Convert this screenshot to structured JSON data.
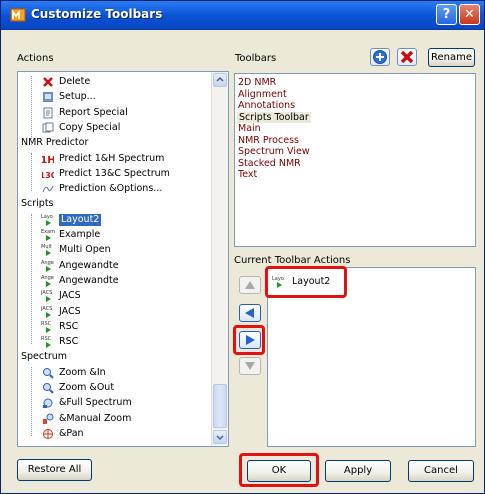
{
  "window": {
    "title": "Customize Toolbars"
  },
  "actions": {
    "label": "Actions",
    "items": [
      {
        "text": "Delete",
        "icon": "red-x-icon",
        "indent": 2
      },
      {
        "text": "Setup...",
        "icon": "setup-icon",
        "indent": 2
      },
      {
        "text": "Report Special",
        "icon": "report-icon",
        "indent": 2
      },
      {
        "text": "Copy Special",
        "icon": "copy-icon",
        "indent": 2
      },
      {
        "text": "NMR Predictor",
        "icon": "",
        "indent": 0
      },
      {
        "text": "Predict 1&H Spectrum",
        "icon": "1h-icon",
        "indent": 2
      },
      {
        "text": "Predict 13&C Spectrum",
        "icon": "13c-icon",
        "indent": 2
      },
      {
        "text": "Prediction &Options...",
        "icon": "prediction-icon",
        "indent": 2
      },
      {
        "text": "Scripts",
        "icon": "",
        "indent": 0
      },
      {
        "text": "Layout2",
        "icon": "script-icon",
        "indent": 2,
        "selected": true
      },
      {
        "text": "Example",
        "icon": "script-icon",
        "indent": 2
      },
      {
        "text": "Multi Open",
        "icon": "script-icon",
        "indent": 2
      },
      {
        "text": "Angewandte",
        "icon": "script-icon",
        "indent": 2
      },
      {
        "text": "Angewandte",
        "icon": "script-icon",
        "indent": 2
      },
      {
        "text": "JACS",
        "icon": "script-icon",
        "indent": 2
      },
      {
        "text": "JACS",
        "icon": "script-icon",
        "indent": 2
      },
      {
        "text": "RSC",
        "icon": "script-icon",
        "indent": 2
      },
      {
        "text": "RSC",
        "icon": "script-icon",
        "indent": 2
      },
      {
        "text": "Spectrum",
        "icon": "",
        "indent": 0
      },
      {
        "text": "Zoom &In",
        "icon": "zoom-in-icon",
        "indent": 2
      },
      {
        "text": "Zoom &Out",
        "icon": "zoom-out-icon",
        "indent": 2
      },
      {
        "text": "&Full Spectrum",
        "icon": "full-spectrum-icon",
        "indent": 2
      },
      {
        "text": "&Manual Zoom",
        "icon": "manual-zoom-icon",
        "indent": 2
      },
      {
        "text": "&Pan",
        "icon": "pan-icon",
        "indent": 2
      }
    ],
    "script_icon_labels": [
      "Layo",
      "Exam",
      "Mult",
      "Ange",
      "Ange",
      "JACS",
      "JACS",
      "RSC",
      "RSC"
    ]
  },
  "toolbars": {
    "label": "Toolbars",
    "rename_label": "Rename",
    "items": [
      "2D NMR",
      "Alignment",
      "Annotations",
      "Scripts Toolbar",
      "Main",
      "NMR Process",
      "Spectrum View",
      "Stacked NMR",
      "Text"
    ],
    "highlighted_index": 3
  },
  "current_actions": {
    "label": "Current Toolbar Actions",
    "items": [
      {
        "text": "Layout2",
        "icon_label": "Layo"
      }
    ]
  },
  "buttons": {
    "restore_all": "Restore All",
    "ok": "OK",
    "apply": "Apply",
    "cancel": "Cancel"
  },
  "colors": {
    "title_bar": "#0a52d6",
    "selection": "#316ac5",
    "toolbar_item_text": "#800000",
    "highlight_box": "#e31212",
    "dialog_bg": "#ece9d8"
  }
}
